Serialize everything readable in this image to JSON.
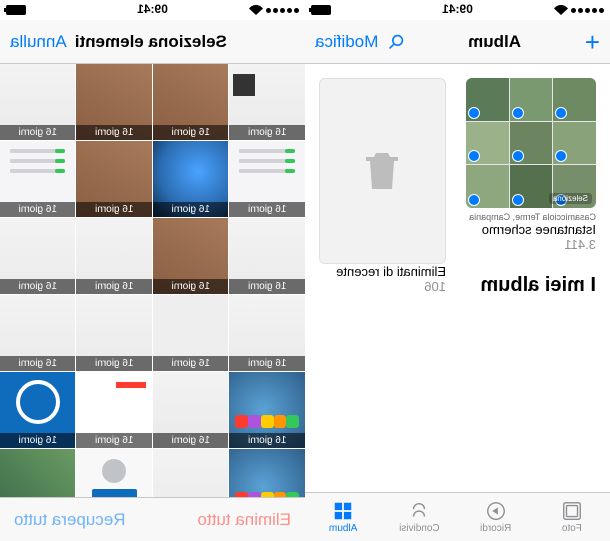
{
  "colors": {
    "accent": "#007aff",
    "destructive": "#ff3b30",
    "inactive": "#8e8e93"
  },
  "status": {
    "time": "09:41"
  },
  "albums": {
    "nav": {
      "title": "Album",
      "add": "+",
      "edit": "Modifica",
      "search_aria": "Cerca"
    },
    "items": [
      {
        "location": "Casamicciola Terme, Campania",
        "name": "Istantanee schermo",
        "count": "3.411",
        "select_caption": "Seleziona"
      },
      {
        "name": "Eliminati di recente",
        "count": "106"
      }
    ],
    "section": "I miei album",
    "tabs": [
      {
        "label": "Foto",
        "icon": "photos-icon",
        "active": false
      },
      {
        "label": "Ricordi",
        "icon": "memories-icon",
        "active": false
      },
      {
        "label": "Condivisi",
        "icon": "shared-icon",
        "active": false
      },
      {
        "label": "Album",
        "icon": "albums-icon",
        "active": true
      }
    ]
  },
  "select": {
    "nav": {
      "title": "Seleziona elementi",
      "cancel": "Annulla"
    },
    "day_label": "16 giorni",
    "cells": [
      {
        "kind": "light",
        "dark_corner": true
      },
      {
        "kind": "wood"
      },
      {
        "kind": "wood"
      },
      {
        "kind": "light"
      },
      {
        "kind": "settings"
      },
      {
        "kind": "phone"
      },
      {
        "kind": "wood"
      },
      {
        "kind": "settings"
      },
      {
        "kind": "light"
      },
      {
        "kind": "wood"
      },
      {
        "kind": "light"
      },
      {
        "kind": "light"
      },
      {
        "kind": "light"
      },
      {
        "kind": "card"
      },
      {
        "kind": "light"
      },
      {
        "kind": "light"
      },
      {
        "kind": "apps"
      },
      {
        "kind": "light"
      },
      {
        "kind": "mail"
      },
      {
        "kind": "outlook"
      },
      {
        "kind": "apps"
      },
      {
        "kind": "light"
      },
      {
        "kind": "user"
      },
      {
        "kind": "green"
      }
    ],
    "toolbar": {
      "delete_all": "Elimina tutto",
      "recover_all": "Recupera tutto"
    }
  }
}
